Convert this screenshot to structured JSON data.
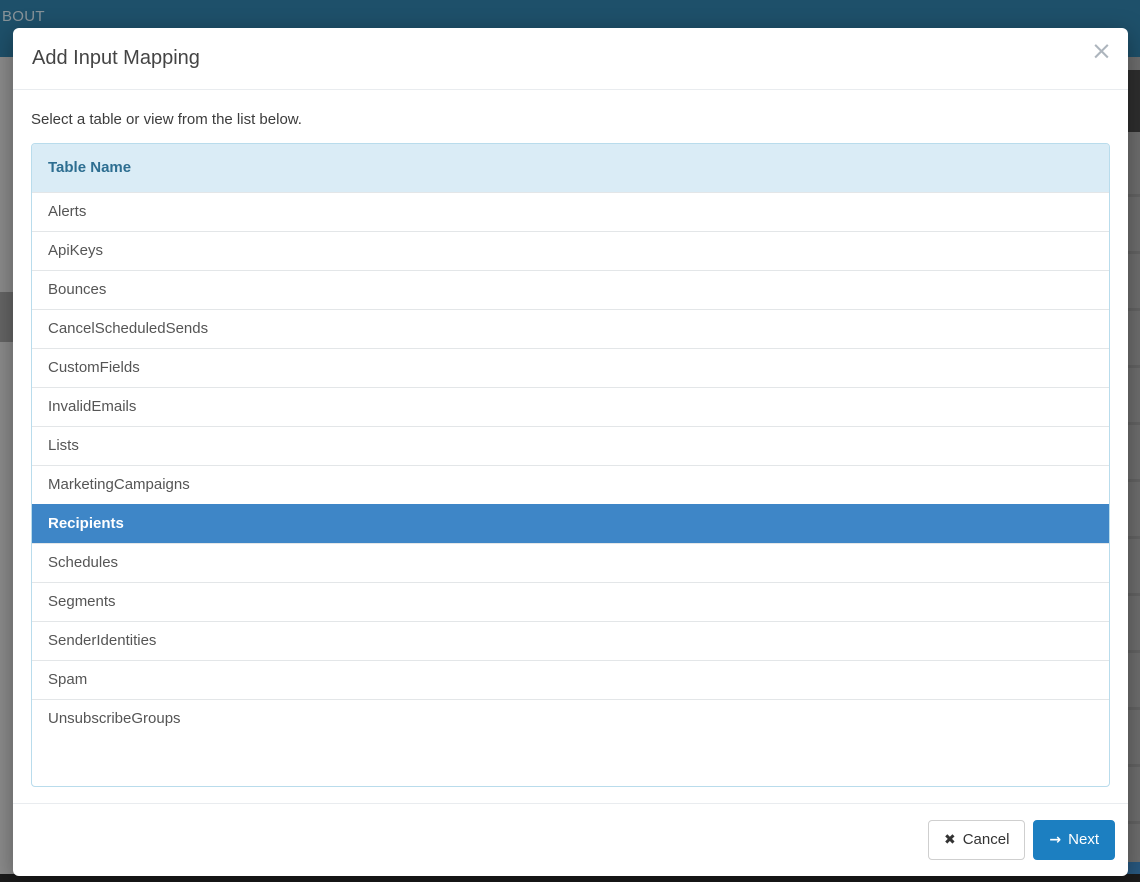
{
  "background": {
    "nav_partial_label": "BOUT"
  },
  "modal": {
    "title": "Add Input Mapping",
    "close_glyph": "×",
    "instruction": "Select a table or view from the list below.",
    "table": {
      "header": "Table Name",
      "rows": [
        "Alerts",
        "ApiKeys",
        "Bounces",
        "CancelScheduledSends",
        "CustomFields",
        "InvalidEmails",
        "Lists",
        "MarketingCampaigns",
        "Recipients",
        "Schedules",
        "Segments",
        "SenderIdentities",
        "Spam",
        "UnsubscribeGroups"
      ],
      "selected_row": "Recipients",
      "selected_index": 8
    },
    "footer": {
      "cancel_label": "Cancel",
      "cancel_icon": "✖",
      "next_label": "Next",
      "next_icon": "→"
    }
  },
  "colors": {
    "primary": "#1c7fc1",
    "selected_bg": "#3e86c7",
    "table_header_bg": "#daecf6",
    "table_header_text": "#2d6e91",
    "table_border": "#b9dcec",
    "navbar_bg": "#2e7ba3"
  }
}
